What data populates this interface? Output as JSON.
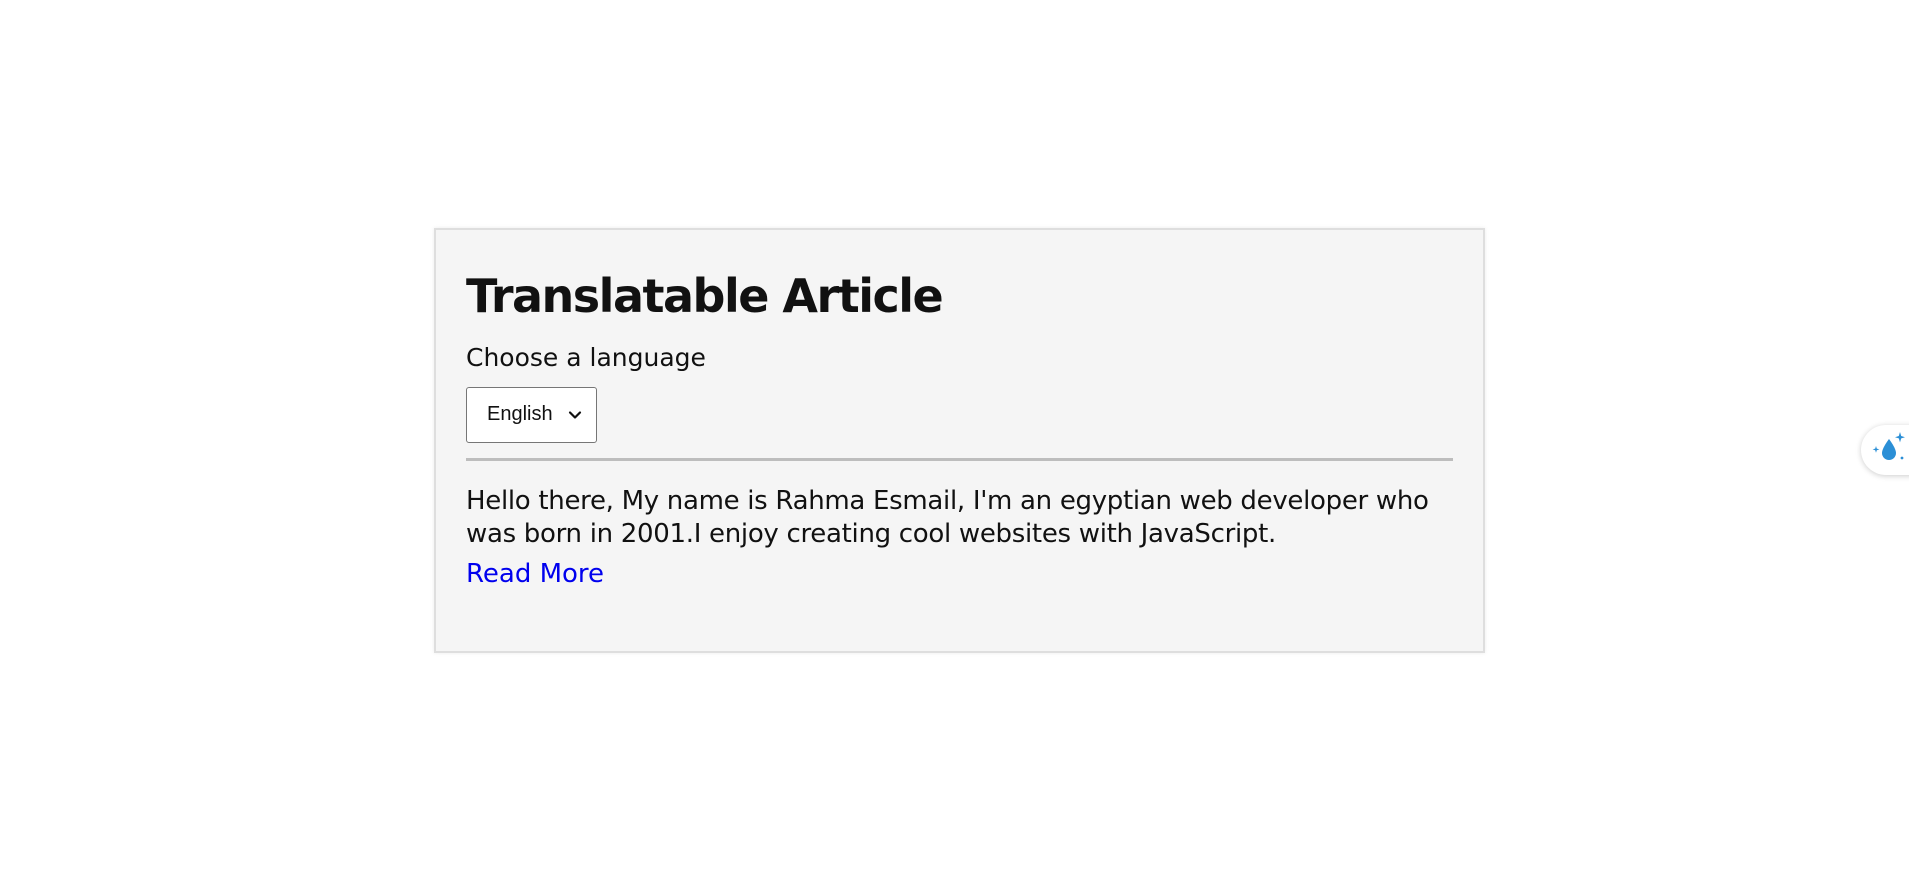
{
  "article": {
    "title": "Translatable Article",
    "language_label": "Choose a language",
    "language_select": {
      "selected": "English"
    },
    "paragraph": "Hello there, My name is Rahma Esmail, I'm an egyptian web developer who was born in 2001.I enjoy creating cool websites with JavaScript.",
    "read_more": "Read More"
  },
  "extension_tab": {
    "icon": "sparkle-droplet-icon"
  },
  "colors": {
    "card_background": "#f5f5f5",
    "link": "#0000ee",
    "extension_icon": "#2b8fd6"
  }
}
